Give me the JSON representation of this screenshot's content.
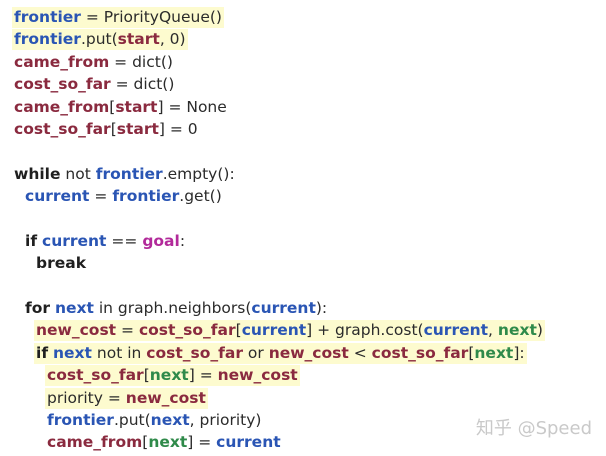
{
  "watermark": "知乎 @Speed",
  "colors": {
    "highlight": "#fdfbcf",
    "var_blue": "#2a55b4",
    "var_maroon": "#8a2a3f",
    "goal_magenta": "#b22a9a",
    "green": "#2f8a4a"
  },
  "lines": [
    {
      "indent": 0,
      "hl": true,
      "tokens": [
        {
          "t": "frontier",
          "c": "var"
        },
        {
          "t": " = ",
          "c": "pl"
        },
        {
          "t": "PriorityQueue()",
          "c": "pl"
        }
      ]
    },
    {
      "indent": 0,
      "hl": true,
      "tokens": [
        {
          "t": "frontier",
          "c": "var"
        },
        {
          "t": ".put(",
          "c": "pl"
        },
        {
          "t": "start",
          "c": "var2"
        },
        {
          "t": ", 0)",
          "c": "pl"
        }
      ]
    },
    {
      "indent": 0,
      "hl": false,
      "tokens": [
        {
          "t": "came_from",
          "c": "var2"
        },
        {
          "t": " = dict()",
          "c": "pl"
        }
      ]
    },
    {
      "indent": 0,
      "hl": false,
      "tokens": [
        {
          "t": "cost_so_far",
          "c": "var2"
        },
        {
          "t": " = dict()",
          "c": "pl"
        }
      ]
    },
    {
      "indent": 0,
      "hl": false,
      "tokens": [
        {
          "t": "came_from",
          "c": "var2"
        },
        {
          "t": "[",
          "c": "pl"
        },
        {
          "t": "start",
          "c": "var2"
        },
        {
          "t": "] = None",
          "c": "pl"
        }
      ]
    },
    {
      "indent": 0,
      "hl": false,
      "tokens": [
        {
          "t": "cost_so_far",
          "c": "var2"
        },
        {
          "t": "[",
          "c": "pl"
        },
        {
          "t": "start",
          "c": "var2"
        },
        {
          "t": "] = 0",
          "c": "pl"
        }
      ]
    },
    {
      "indent": 0,
      "hl": false,
      "tokens": []
    },
    {
      "indent": 0,
      "hl": false,
      "tokens": [
        {
          "t": "while",
          "c": "kw"
        },
        {
          "t": " not ",
          "c": "pl"
        },
        {
          "t": "frontier",
          "c": "var"
        },
        {
          "t": ".empty():",
          "c": "pl"
        }
      ]
    },
    {
      "indent": 1,
      "hl": false,
      "tokens": [
        {
          "t": "current",
          "c": "var"
        },
        {
          "t": " = ",
          "c": "pl"
        },
        {
          "t": "frontier",
          "c": "var"
        },
        {
          "t": ".get()",
          "c": "pl"
        }
      ]
    },
    {
      "indent": 0,
      "hl": false,
      "tokens": []
    },
    {
      "indent": 1,
      "hl": false,
      "tokens": [
        {
          "t": "if",
          "c": "kw"
        },
        {
          "t": " ",
          "c": "pl"
        },
        {
          "t": "current",
          "c": "var"
        },
        {
          "t": " == ",
          "c": "pl"
        },
        {
          "t": "goal",
          "c": "goal"
        },
        {
          "t": ":",
          "c": "pl"
        }
      ]
    },
    {
      "indent": 2,
      "hl": false,
      "tokens": [
        {
          "t": "break",
          "c": "kw"
        }
      ]
    },
    {
      "indent": 0,
      "hl": false,
      "tokens": []
    },
    {
      "indent": 1,
      "hl": false,
      "tokens": [
        {
          "t": "for",
          "c": "kw"
        },
        {
          "t": " ",
          "c": "pl"
        },
        {
          "t": "next",
          "c": "var"
        },
        {
          "t": " in graph.neighbors(",
          "c": "pl"
        },
        {
          "t": "current",
          "c": "var"
        },
        {
          "t": "):",
          "c": "pl"
        }
      ]
    },
    {
      "indent": 2,
      "hl": true,
      "tokens": [
        {
          "t": "new_cost",
          "c": "var2"
        },
        {
          "t": " = ",
          "c": "pl"
        },
        {
          "t": "cost_so_far",
          "c": "var2"
        },
        {
          "t": "[",
          "c": "pl"
        },
        {
          "t": "current",
          "c": "var"
        },
        {
          "t": "] + graph.cost(",
          "c": "pl"
        },
        {
          "t": "current",
          "c": "var"
        },
        {
          "t": ", ",
          "c": "pl"
        },
        {
          "t": "next",
          "c": "green"
        },
        {
          "t": ")",
          "c": "pl"
        }
      ]
    },
    {
      "indent": 2,
      "hl": true,
      "tokens": [
        {
          "t": "if",
          "c": "kw"
        },
        {
          "t": " ",
          "c": "pl"
        },
        {
          "t": "next",
          "c": "var"
        },
        {
          "t": " not in ",
          "c": "pl"
        },
        {
          "t": "cost_so_far",
          "c": "var2"
        },
        {
          "t": " or ",
          "c": "pl"
        },
        {
          "t": "new_cost",
          "c": "var2"
        },
        {
          "t": " < ",
          "c": "pl"
        },
        {
          "t": "cost_so_far",
          "c": "var2"
        },
        {
          "t": "[",
          "c": "pl"
        },
        {
          "t": "next",
          "c": "green"
        },
        {
          "t": "]:",
          "c": "pl"
        }
      ]
    },
    {
      "indent": 3,
      "hl": true,
      "tokens": [
        {
          "t": "cost_so_far",
          "c": "var2"
        },
        {
          "t": "[",
          "c": "pl"
        },
        {
          "t": "next",
          "c": "green"
        },
        {
          "t": "] = ",
          "c": "pl"
        },
        {
          "t": "new_cost",
          "c": "var2"
        }
      ]
    },
    {
      "indent": 3,
      "hl": true,
      "tokens": [
        {
          "t": "priority = ",
          "c": "pl"
        },
        {
          "t": "new_cost",
          "c": "var2"
        }
      ]
    },
    {
      "indent": 3,
      "hl": false,
      "tokens": [
        {
          "t": "frontier",
          "c": "var"
        },
        {
          "t": ".put(",
          "c": "pl"
        },
        {
          "t": "next",
          "c": "var"
        },
        {
          "t": ", priority)",
          "c": "pl"
        }
      ]
    },
    {
      "indent": 3,
      "hl": false,
      "tokens": [
        {
          "t": "came_from",
          "c": "var2"
        },
        {
          "t": "[",
          "c": "pl"
        },
        {
          "t": "next",
          "c": "green"
        },
        {
          "t": "] = ",
          "c": "pl"
        },
        {
          "t": "current",
          "c": "var"
        }
      ]
    }
  ]
}
